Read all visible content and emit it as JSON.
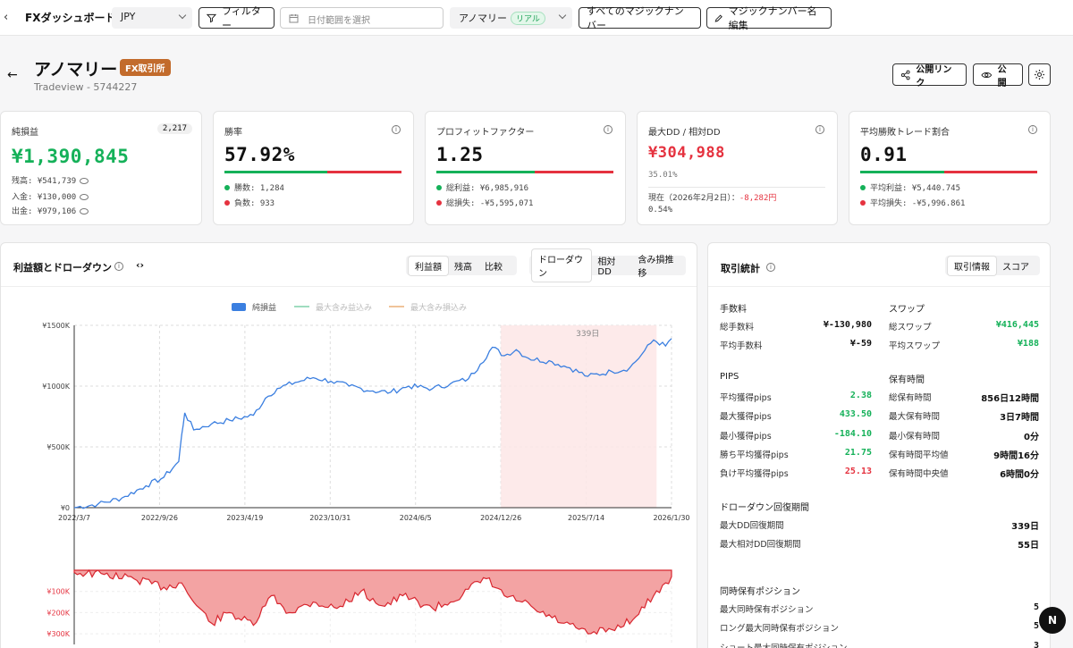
{
  "topbar": {
    "back": "‹",
    "title": "FXダッシュボード",
    "currency": "JPY",
    "filter_label": "フィルター",
    "date_placeholder": "日付範囲を選択",
    "account_name": "アノマリー",
    "account_badge": "リアル",
    "all_magic_label": "すべてのマジックナンバー",
    "edit_magic_label": "マジックナンバー名編集"
  },
  "header": {
    "title": "アノマリー",
    "broker_badge": "FX取引所",
    "subtitle": "Tradeview - 5744227",
    "public_link_label": "公開リンク",
    "public_label": "公開"
  },
  "cards": {
    "pnl": {
      "label": "純損益",
      "count": "2,217",
      "value": "¥1,390,845",
      "balance": "残高: ¥541,739",
      "deposit": "入金: ¥130,000",
      "withdraw": "出金: ¥979,106"
    },
    "winrate": {
      "label": "勝率",
      "value": "57.92%",
      "win_fraction": 0.5792,
      "wins": "勝数: 1,284",
      "losses": "負数: 933"
    },
    "pf": {
      "label": "プロフィットファクター",
      "value": "1.25",
      "win_fraction": 0.555,
      "gross_profit": "総利益: ¥6,985,916",
      "gross_loss": "総損失: -¥5,595,071"
    },
    "dd": {
      "label": "最大DD / 相対DD",
      "value": "¥304,988",
      "relative": "35.01%",
      "current_label": "現在（2026年2月2日）：",
      "current_value": "-8,282円",
      "current_pct": "0.54%"
    },
    "avgratio": {
      "label": "平均勝敗トレード割合",
      "value": "0.91",
      "win_fraction": 0.476,
      "avg_profit": "平均利益: ¥5,440.745",
      "avg_loss": "平均損失: -¥5,996.861"
    }
  },
  "chart_panel": {
    "title": "利益額とドローダウン",
    "tabs1": [
      "利益額",
      "残高",
      "比較"
    ],
    "tabs2": [
      "ドローダウン",
      "相対DD",
      "含み損推移"
    ],
    "legend": [
      "純損益",
      "最大含み益込み",
      "最大含み損込み"
    ],
    "highlight_label": "339日"
  },
  "chart_data": {
    "type": "line",
    "title": "利益額とドローダウン",
    "x_ticks": [
      "2022/3/7",
      "2022/9/26",
      "2023/4/19",
      "2023/10/31",
      "2024/6/5",
      "2024/12/26",
      "2025/7/14",
      "2026/1/30"
    ],
    "y_ticks": [
      "¥0",
      "¥500K",
      "¥1000K",
      "¥1500K"
    ],
    "ylim": [
      0,
      1500000
    ],
    "dd_ticks": [
      "¥100K",
      "¥200K",
      "¥300K"
    ],
    "dd_ylim": [
      0,
      350000
    ],
    "highlight": {
      "from": "2024/12/26",
      "to": "2026/1/20",
      "label": "339日"
    },
    "series": [
      {
        "name": "純損益",
        "color": "#3b7fe0",
        "points": [
          [
            0,
            0
          ],
          [
            0.04,
            30000
          ],
          [
            0.08,
            80000
          ],
          [
            0.12,
            180000
          ],
          [
            0.15,
            250000
          ],
          [
            0.175,
            380000
          ],
          [
            0.18,
            600000
          ],
          [
            0.185,
            780000
          ],
          [
            0.2,
            640000
          ],
          [
            0.23,
            690000
          ],
          [
            0.26,
            720000
          ],
          [
            0.3,
            760000
          ],
          [
            0.32,
            900000
          ],
          [
            0.34,
            980000
          ],
          [
            0.37,
            1030000
          ],
          [
            0.4,
            1070000
          ],
          [
            0.43,
            1040000
          ],
          [
            0.46,
            1000000
          ],
          [
            0.5,
            960000
          ],
          [
            0.53,
            950000
          ],
          [
            0.56,
            1000000
          ],
          [
            0.6,
            980000
          ],
          [
            0.63,
            1020000
          ],
          [
            0.66,
            1060000
          ],
          [
            0.68,
            1180000
          ],
          [
            0.7,
            1320000
          ],
          [
            0.72,
            1250000
          ],
          [
            0.74,
            1300000
          ],
          [
            0.76,
            1230000
          ],
          [
            0.8,
            1200000
          ],
          [
            0.83,
            1150000
          ],
          [
            0.86,
            1080000
          ],
          [
            0.9,
            1120000
          ],
          [
            0.93,
            1150000
          ],
          [
            0.95,
            1260000
          ],
          [
            0.97,
            1380000
          ],
          [
            0.99,
            1330000
          ],
          [
            1.0,
            1390845
          ]
        ]
      },
      {
        "name": "ドローダウン",
        "color": "#e5323f",
        "points": [
          [
            0,
            10000
          ],
          [
            0.05,
            20000
          ],
          [
            0.1,
            40000
          ],
          [
            0.15,
            80000
          ],
          [
            0.18,
            60000
          ],
          [
            0.2,
            150000
          ],
          [
            0.23,
            250000
          ],
          [
            0.26,
            200000
          ],
          [
            0.3,
            260000
          ],
          [
            0.33,
            120000
          ],
          [
            0.36,
            200000
          ],
          [
            0.4,
            150000
          ],
          [
            0.44,
            180000
          ],
          [
            0.48,
            100000
          ],
          [
            0.52,
            170000
          ],
          [
            0.55,
            120000
          ],
          [
            0.6,
            180000
          ],
          [
            0.63,
            150000
          ],
          [
            0.66,
            90000
          ],
          [
            0.69,
            40000
          ],
          [
            0.72,
            120000
          ],
          [
            0.75,
            150000
          ],
          [
            0.78,
            200000
          ],
          [
            0.82,
            250000
          ],
          [
            0.86,
            300000
          ],
          [
            0.9,
            280000
          ],
          [
            0.94,
            220000
          ],
          [
            0.97,
            120000
          ],
          [
            0.99,
            60000
          ],
          [
            1.0,
            30000
          ]
        ]
      }
    ]
  },
  "stats": {
    "title": "取引統計",
    "tabs": [
      "取引情報",
      "スコア"
    ],
    "fees": {
      "title": "手数料",
      "rows": [
        {
          "label": "総手数料",
          "value": "¥-130,980",
          "tone": "black"
        },
        {
          "label": "平均手数料",
          "value": "¥-59",
          "tone": "black"
        }
      ]
    },
    "swap": {
      "title": "スワップ",
      "rows": [
        {
          "label": "総スワップ",
          "value": "¥416,445",
          "tone": "green"
        },
        {
          "label": "平均スワップ",
          "value": "¥188",
          "tone": "green"
        }
      ]
    },
    "pips": {
      "title": "PIPS",
      "rows": [
        {
          "label": "平均獲得pips",
          "value": "2.38",
          "tone": "green"
        },
        {
          "label": "最大獲得pips",
          "value": "433.50",
          "tone": "green"
        },
        {
          "label": "最小獲得pips",
          "value": "-184.10",
          "tone": "green"
        },
        {
          "label": "勝ち平均獲得pips",
          "value": "21.75",
          "tone": "green"
        },
        {
          "label": "負け平均獲得pips",
          "value": "25.13",
          "tone": "red"
        }
      ]
    },
    "hold": {
      "title": "保有時間",
      "rows": [
        {
          "label": "総保有時間",
          "value": "856日12時間",
          "tone": "black"
        },
        {
          "label": "最大保有時間",
          "value": "3日7時間",
          "tone": "black"
        },
        {
          "label": "最小保有時間",
          "value": "0分",
          "tone": "black"
        },
        {
          "label": "保有時間平均値",
          "value": "9時間16分",
          "tone": "black"
        },
        {
          "label": "保有時間中央値",
          "value": "6時間0分",
          "tone": "black"
        }
      ]
    },
    "recovery": {
      "title": "ドローダウン回復期間",
      "rows": [
        {
          "label": "最大DD回復期間",
          "value": "339日"
        },
        {
          "label": "最大相対DD回復期間",
          "value": "55日"
        }
      ]
    },
    "positions": {
      "title": "同時保有ポジション",
      "rows": [
        {
          "label": "最大同時保有ポジション",
          "value": "5"
        },
        {
          "label": "ロング最大同時保有ポジション",
          "value": "5"
        },
        {
          "label": "ショート最大同時保有ポジション",
          "value": "3"
        }
      ]
    }
  },
  "fab_label": "N"
}
